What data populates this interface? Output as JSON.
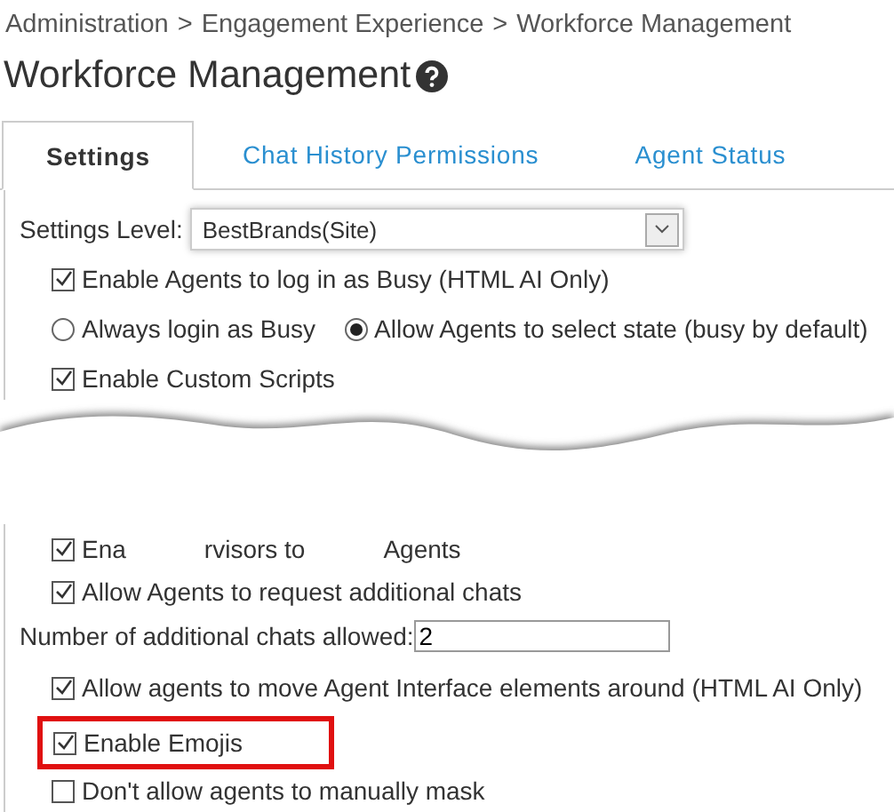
{
  "breadcrumb": [
    "Administration",
    "Engagement Experience",
    "Workforce Management"
  ],
  "breadcrumb_separator": ">",
  "title": "Workforce Management",
  "tabs": [
    {
      "label": "Settings",
      "selected": true
    },
    {
      "label": "Chat History Permissions",
      "selected": false
    },
    {
      "label": "Agent Status",
      "selected": false
    }
  ],
  "settings_level": {
    "label": "Settings Level:",
    "value": "BestBrands(Site)"
  },
  "top_options": [
    {
      "kind": "checkbox",
      "label": "Enable Agents to log in as Busy (HTML AI Only)",
      "checked": true
    },
    {
      "kind": "radios",
      "options": [
        {
          "label": "Always login as Busy",
          "selected": false
        },
        {
          "label": "Allow Agents to select state (busy by default)",
          "selected": true
        }
      ]
    },
    {
      "kind": "checkbox",
      "label": "Enable Custom Scripts",
      "checked": true
    }
  ],
  "bottom_options": [
    {
      "kind": "fragments",
      "parts": [
        "Ena",
        "rvisors to",
        "Agents"
      ],
      "checked": true
    },
    {
      "kind": "checkbox",
      "label": "Allow Agents to request additional chats",
      "checked": true
    },
    {
      "kind": "field",
      "label": "Number of additional chats allowed:",
      "value": "2"
    },
    {
      "kind": "checkbox",
      "label": "Allow agents to move Agent Interface elements around (HTML AI Only)",
      "checked": true
    },
    {
      "kind": "checkbox",
      "label": "Enable Emojis",
      "checked": true,
      "highlighted": true
    },
    {
      "kind": "checkbox",
      "label": "Don't allow agents to manually mask",
      "checked": false
    }
  ]
}
